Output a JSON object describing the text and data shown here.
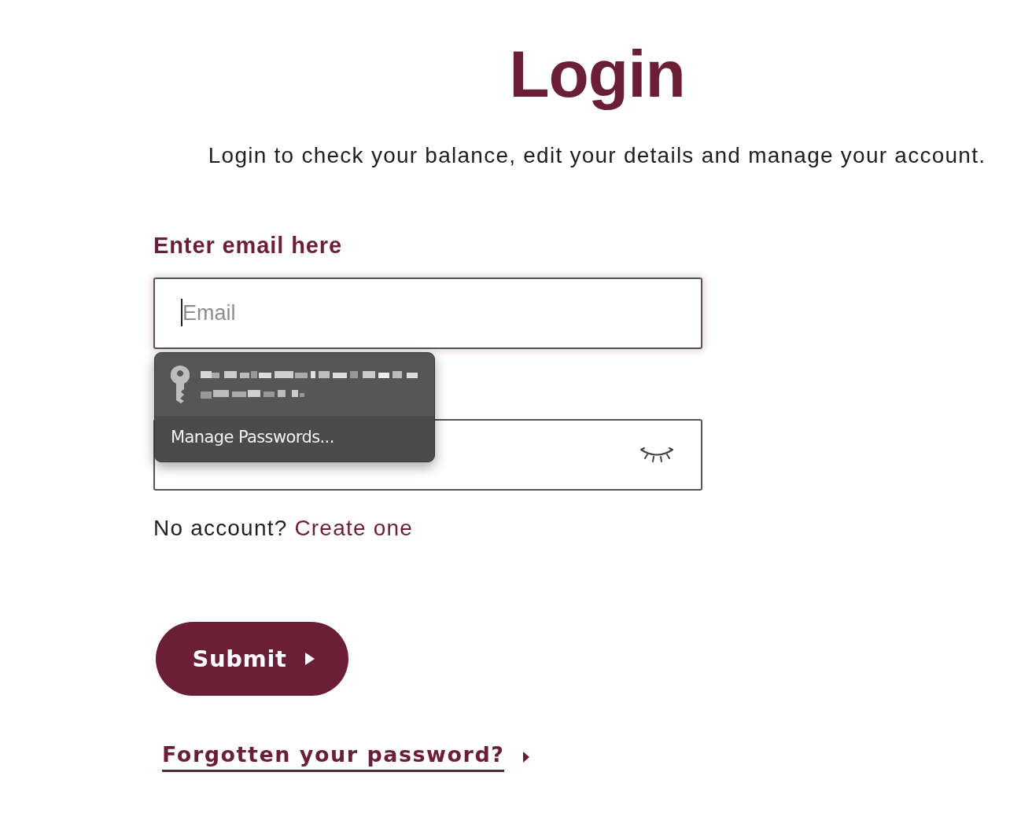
{
  "header": {
    "title": "Login",
    "subtitle": "Login to check your balance, edit your details and manage your account."
  },
  "email": {
    "label": "Enter email here",
    "placeholder": "Email",
    "focused": true
  },
  "password": {
    "visible": false
  },
  "autofill_popup": {
    "open": true,
    "action": "Manage Passwords..."
  },
  "signup": {
    "prompt": "No account?",
    "link": "Create one"
  },
  "submit": {
    "label": "Submit"
  },
  "forgot": {
    "label": "Forgotten your password?"
  }
}
